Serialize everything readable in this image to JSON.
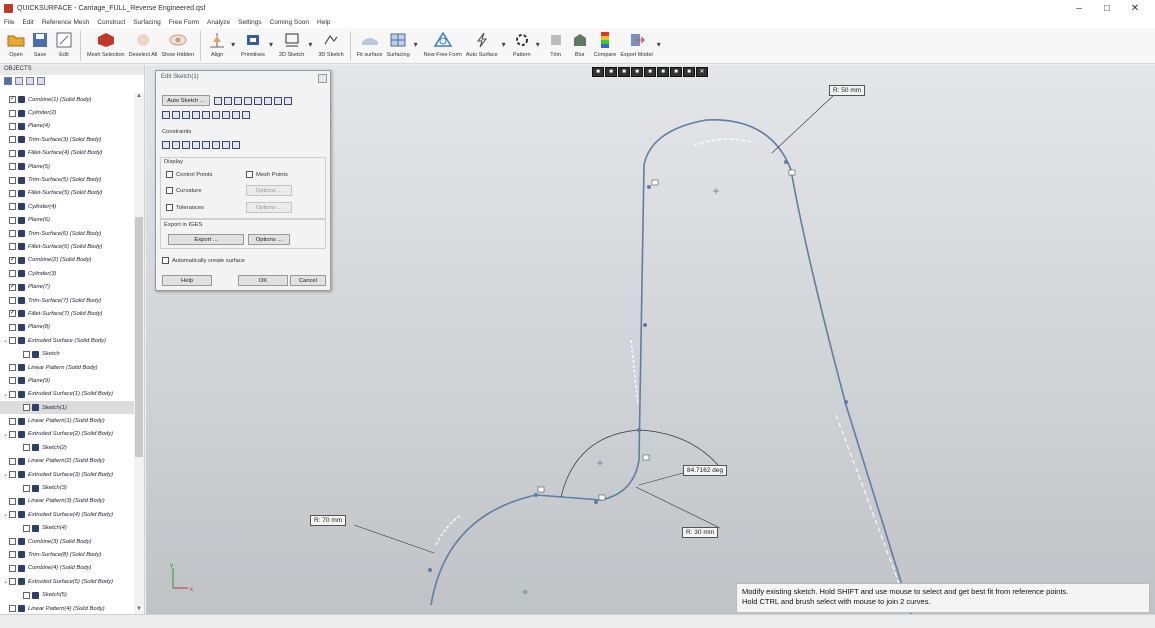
{
  "window": {
    "title": "QUICKSURFACE - Carriage_FULL_Reverse Engineered.qsf",
    "minimize": "–",
    "maximize": "□",
    "close": "✕"
  },
  "menu": [
    "File",
    "Edit",
    "Reference Mesh",
    "Construct",
    "Surfacing",
    "Free Form",
    "Analyze",
    "Settings",
    "Coming Soon",
    "Help"
  ],
  "toolbar": [
    {
      "label": "Open",
      "icon": "folder-icon"
    },
    {
      "label": "Save",
      "icon": "save-icon"
    },
    {
      "label": "Edit",
      "icon": "edit-icon"
    },
    {
      "label": "Mesh Selection",
      "icon": "mesh-selection-icon"
    },
    {
      "label": "Deselect All",
      "icon": "deselect-icon"
    },
    {
      "label": "Show Hidden",
      "icon": "eye-icon"
    },
    {
      "label": "Align",
      "icon": "align-icon"
    },
    {
      "label": "Primitives",
      "icon": "primitives-icon"
    },
    {
      "label": "2D Sketch",
      "icon": "sketch-2d-icon"
    },
    {
      "label": "3D Sketch",
      "icon": "sketch-3d-icon"
    },
    {
      "label": "Fit surface",
      "icon": "fit-surface-icon"
    },
    {
      "label": "Surfacing",
      "icon": "surfacing-icon"
    },
    {
      "label": "New Free Form",
      "icon": "free-form-icon"
    },
    {
      "label": "Auto Surface",
      "icon": "auto-surface-icon"
    },
    {
      "label": "Pattern",
      "icon": "pattern-icon"
    },
    {
      "label": "Trim",
      "icon": "trim-icon"
    },
    {
      "label": "Blur",
      "icon": "blur-icon"
    },
    {
      "label": "Compare",
      "icon": "compare-icon"
    },
    {
      "label": "Export Model",
      "icon": "export-icon"
    }
  ],
  "objects_panel": {
    "title": "OBJECTS",
    "items": [
      {
        "label": "Combine(1) (Solid Body)",
        "checked": "✓",
        "expander": ""
      },
      {
        "label": "Cylinder(2)",
        "checked": "",
        "expander": ""
      },
      {
        "label": "Plane(4)",
        "checked": "",
        "expander": ""
      },
      {
        "label": "Trim-Surface(3) (Solid Body)",
        "checked": "",
        "expander": ""
      },
      {
        "label": "Fillet-Surface(4) (Solid Body)",
        "checked": "",
        "expander": ""
      },
      {
        "label": "Plane(5)",
        "checked": "",
        "expander": ""
      },
      {
        "label": "Trim-Surface(5) (Solid Body)",
        "checked": "",
        "expander": ""
      },
      {
        "label": "Fillet-Surface(5) (Solid Body)",
        "checked": "",
        "expander": ""
      },
      {
        "label": "Cylinder(4)",
        "checked": "",
        "expander": ""
      },
      {
        "label": "Plane(6)",
        "checked": "",
        "expander": ""
      },
      {
        "label": "Trim-Surface(6) (Solid Body)",
        "checked": "",
        "expander": ""
      },
      {
        "label": "Fillet-Surface(6) (Solid Body)",
        "checked": "",
        "expander": ""
      },
      {
        "label": "Combine(2) (Solid Body)",
        "checked": "✓",
        "expander": ""
      },
      {
        "label": "Cylinder(3)",
        "checked": "",
        "expander": ""
      },
      {
        "label": "Plane(7)",
        "checked": "✓",
        "expander": ""
      },
      {
        "label": "Trim-Surface(7) (Solid Body)",
        "checked": "",
        "expander": ""
      },
      {
        "label": "Fillet-Surface(7) (Solid Body)",
        "checked": "✓",
        "expander": ""
      },
      {
        "label": "Plane(8)",
        "checked": "",
        "expander": ""
      },
      {
        "label": "Extruded Surface (Solid Body)",
        "checked": "",
        "expander": "⌄"
      },
      {
        "label": "Sketch",
        "checked": "",
        "expander": ""
      },
      {
        "label": "Linear Pattern (Solid Body)",
        "checked": "",
        "expander": ""
      },
      {
        "label": "Plane(9)",
        "checked": "",
        "expander": ""
      },
      {
        "label": "Extruded Surface(1) (Solid Body)",
        "checked": "",
        "expander": "⌄"
      },
      {
        "label": "Sketch(1)",
        "checked": "",
        "expander": "",
        "selected": true
      },
      {
        "label": "Linear Pattern(1) (Solid Body)",
        "checked": "",
        "expander": ""
      },
      {
        "label": "Extruded Surface(2) (Solid Body)",
        "checked": "",
        "expander": "⌄"
      },
      {
        "label": "Sketch(2)",
        "checked": "",
        "expander": ""
      },
      {
        "label": "Linear Pattern(2) (Solid Body)",
        "checked": "",
        "expander": ""
      },
      {
        "label": "Extruded Surface(3) (Solid Body)",
        "checked": "",
        "expander": "⌄"
      },
      {
        "label": "Sketch(3)",
        "checked": "",
        "expander": ""
      },
      {
        "label": "Linear Pattern(3) (Solid Body)",
        "checked": "",
        "expander": ""
      },
      {
        "label": "Extruded Surface(4) (Solid Body)",
        "checked": "",
        "expander": "⌄"
      },
      {
        "label": "Sketch(4)",
        "checked": "",
        "expander": ""
      },
      {
        "label": "Combine(3) (Solid Body)",
        "checked": "",
        "expander": ""
      },
      {
        "label": "Trim-Surface(8) (Solid Body)",
        "checked": "",
        "expander": ""
      },
      {
        "label": "Combine(4) (Solid Body)",
        "checked": "",
        "expander": ""
      },
      {
        "label": "Extruded Surface(5) (Solid Body)",
        "checked": "",
        "expander": "⌄"
      },
      {
        "label": "Sketch(5)",
        "checked": "",
        "expander": ""
      },
      {
        "label": "Linear Pattern(4) (Solid Body)",
        "checked": "",
        "expander": ""
      }
    ]
  },
  "dialog": {
    "title": "Edit Sketch(1)",
    "auto_sketch": "Auto Sketch ...",
    "constraints_label": "Constraints",
    "display_label": "Display",
    "control_points": "Control Points",
    "mesh_points": "Mesh Points",
    "curvature": "Curvature",
    "tolerances": "Tolerances",
    "options": "Options ...",
    "export_label": "Export in IGES",
    "export_btn": "Export ...",
    "auto_create": "Automatically create surface",
    "help": "Help",
    "ok": "OK",
    "cancel": "Cancel"
  },
  "viewport": {
    "dims": {
      "r50": "R: 50 mm",
      "angle": "84.7162 deg",
      "r30": "R: 30 mm",
      "r70": "R: 70 mm"
    },
    "hint_line1": "Modify existing sketch. Hold SHIFT and use mouse to select and get best fit from reference points.",
    "hint_line2": "Hold CTRL and brush select with mouse to join 2 curves.",
    "axis_y": "y",
    "axis_x": "x"
  },
  "colors": {
    "curve": "#5b7fa6",
    "accent": "#2b6cb0"
  }
}
